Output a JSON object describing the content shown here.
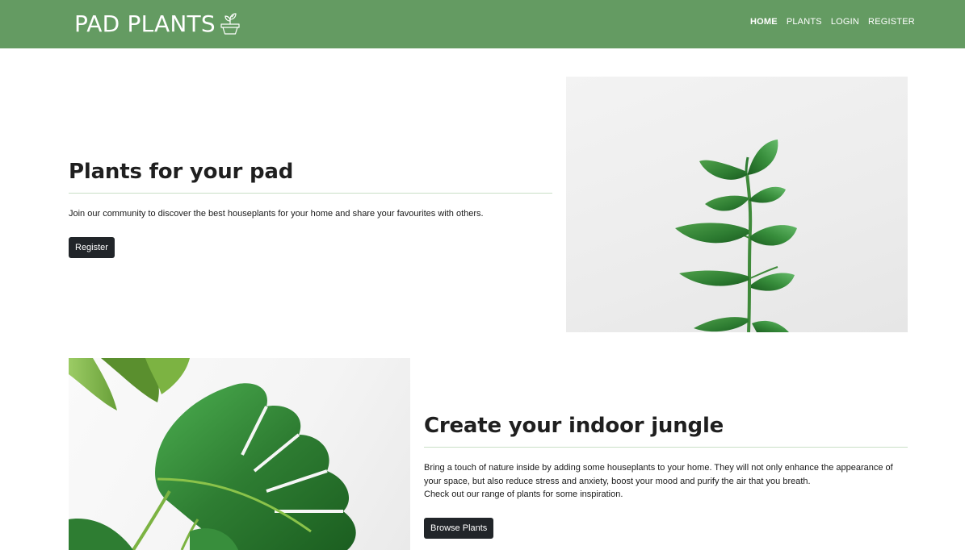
{
  "navbar": {
    "brand": "PAD PLANTS",
    "brand_icon": "potted-plant-icon",
    "links": [
      {
        "label": "HOME",
        "active": true
      },
      {
        "label": "PLANTS",
        "active": false
      },
      {
        "label": "LOGIN",
        "active": false
      },
      {
        "label": "REGISTER",
        "active": false
      }
    ]
  },
  "hero": {
    "title": "Plants for your pad",
    "text": "Join our community to discover the best houseplants for your home and share your favourites with others.",
    "button": "Register",
    "image": "rubber-plant-photo"
  },
  "jungle": {
    "title": "Create your indoor jungle",
    "text_lines": [
      "Bring a touch of nature inside by adding some houseplants to your home. They will not only enhance the appearance of",
      "your space, but also reduce stress and anxiety, boost your mood and purify the air that you breath.",
      "Check out our range of plants for some inspiration."
    ],
    "button": "Browse Plants",
    "image": "monstera-leaf-photo"
  },
  "colors": {
    "navbar": "#649b62",
    "button": "#212529",
    "rule": "#c9dfc6"
  }
}
